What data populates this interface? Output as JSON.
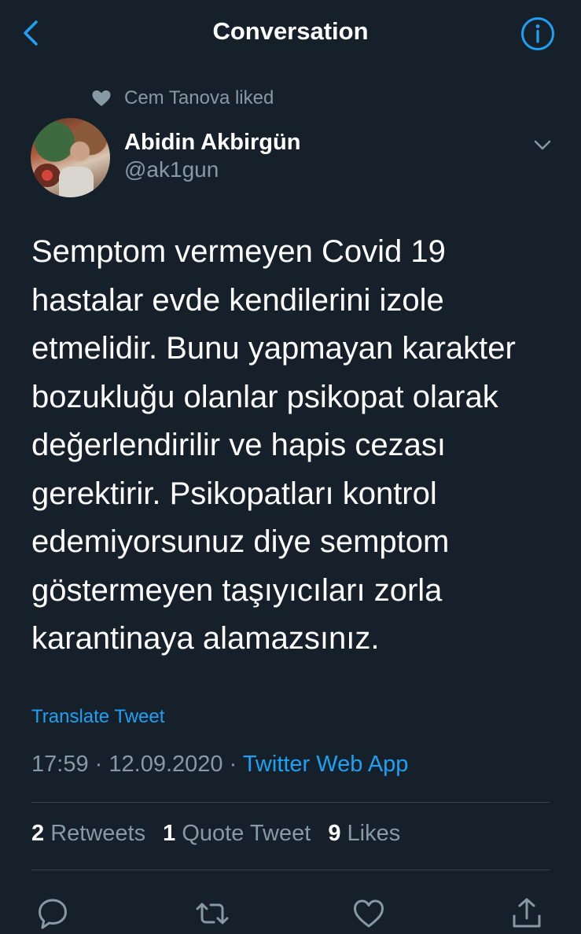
{
  "header": {
    "title": "Conversation",
    "back_icon": "chevron-left-icon",
    "info_icon": "info-icon",
    "accent": "#1da1f2"
  },
  "social_context": {
    "text": "Cem Tanova liked",
    "icon": "heart-icon"
  },
  "author": {
    "name": "Abidin Akbirgün",
    "handle": "@ak1gun"
  },
  "tweet": {
    "text": "Semptom vermeyen Covid 19\nhastalar evde kendilerini izole\netmelidir. Bunu yapmayan karakter\nbozukluğu olanlar psikopat olarak\ndeğerlendirilir ve hapis cezası\ngerektirir. Psikopatları kontrol\nedemiyorsunuz diye semptom\ngöstermeyen taşıyıcıları zorla\nkarantinaya alamazsınız.",
    "translate_label": "Translate Tweet",
    "time": "17:59",
    "separator": "·",
    "date": "12.09.2020",
    "source": "Twitter Web App"
  },
  "stats": {
    "retweets_count": "2",
    "retweets_label": "Retweets",
    "quotes_count": "1",
    "quotes_label": "Quote Tweet",
    "likes_count": "9",
    "likes_label": "Likes"
  },
  "actions": [
    "reply-icon",
    "retweet-icon",
    "like-icon",
    "share-icon"
  ],
  "colors": {
    "background": "#15202b",
    "secondary_text": "#8899a6",
    "divider": "#38444d"
  }
}
